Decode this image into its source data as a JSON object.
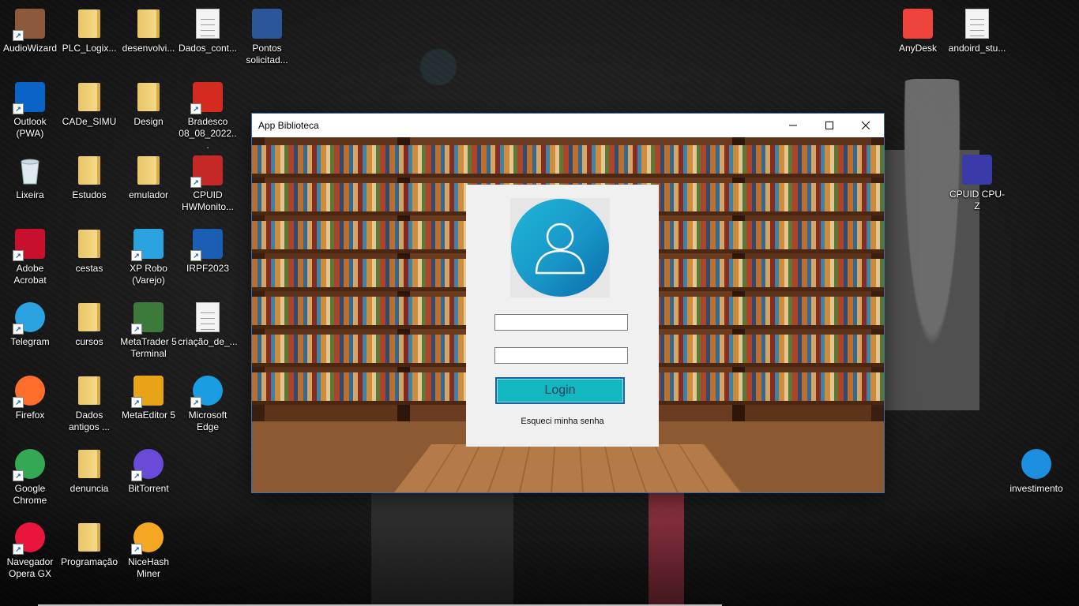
{
  "desktop": {
    "icons_left": [
      {
        "label": "AudioWizard",
        "icon": "speaker-icon",
        "color": "#8a5a3a"
      },
      {
        "label": "PLC_Logix...",
        "icon": "folder-icon"
      },
      {
        "label": "desenvolvi...",
        "icon": "folder-icon"
      },
      {
        "label": "Dados_cont...",
        "icon": "document-icon"
      },
      {
        "label": "Pontos solicitad...",
        "icon": "word-document-icon",
        "color": "#2b579a"
      },
      {
        "label": "Outlook (PWA)",
        "icon": "outlook-icon",
        "color": "#0a64c8"
      },
      {
        "label": "CADe_SIMU",
        "icon": "folder-icon"
      },
      {
        "label": "Design",
        "icon": "folder-icon"
      },
      {
        "label": "Bradesco 08_08_2022...",
        "icon": "pdf-icon",
        "color": "#d42a1f"
      },
      {
        "label": "Lixeira",
        "icon": "recycle-bin-icon"
      },
      {
        "label": "Estudos",
        "icon": "folder-icon"
      },
      {
        "label": "emulador",
        "icon": "folder-icon"
      },
      {
        "label": "CPUID HWMonito...",
        "icon": "hwmonitor-icon",
        "color": "#c62828"
      },
      {
        "label": "Adobe Acrobat",
        "icon": "acrobat-icon",
        "color": "#c8102e"
      },
      {
        "label": "cestas",
        "icon": "folder-icon"
      },
      {
        "label": "XP Robo (Varejo)",
        "icon": "robot-icon",
        "color": "#2aa3e0"
      },
      {
        "label": "IRPF2023",
        "icon": "irpf-icon",
        "color": "#1b5fb5"
      },
      {
        "label": "Telegram",
        "icon": "telegram-icon",
        "color": "#2aa3e0"
      },
      {
        "label": "cursos",
        "icon": "folder-icon"
      },
      {
        "label": "MetaTrader 5 Terminal",
        "icon": "metatrader-icon",
        "color": "#3c7a3c"
      },
      {
        "label": "criação_de_...",
        "icon": "document-icon"
      },
      {
        "label": "Firefox",
        "icon": "firefox-icon",
        "color": "#ff6d2a"
      },
      {
        "label": "Dados antigos ...",
        "icon": "folder-icon"
      },
      {
        "label": "MetaEditor 5",
        "icon": "metaeditor-icon",
        "color": "#e8a317"
      },
      {
        "label": "Microsoft Edge",
        "icon": "edge-icon",
        "color": "#1b9de2"
      },
      {
        "label": "Google Chrome",
        "icon": "chrome-icon",
        "color": "#34a853"
      },
      {
        "label": "denuncia",
        "icon": "folder-icon"
      },
      {
        "label": "BitTorrent",
        "icon": "bittorrent-icon",
        "color": "#6a4bd8"
      },
      {
        "label": "Navegador Opera GX",
        "icon": "opera-gx-icon",
        "color": "#e8163c"
      },
      {
        "label": "Programação",
        "icon": "folder-icon"
      },
      {
        "label": "NiceHash Miner",
        "icon": "nicehash-icon",
        "color": "#f5a623"
      }
    ],
    "icons_right": [
      {
        "label": "AnyDesk",
        "icon": "anydesk-icon",
        "color": "#ef443b"
      },
      {
        "label": "andoird_stu...",
        "icon": "document-icon"
      },
      {
        "label": "CPUID CPU-Z",
        "icon": "cpuz-icon",
        "color": "#3a3aa8"
      },
      {
        "label": "investimento",
        "icon": "investimento-icon",
        "color": "#1d8fe0"
      }
    ]
  },
  "window": {
    "title": "App Biblioteca",
    "controls": {
      "minimize": "—",
      "maximize": "☐",
      "close": "✕"
    }
  },
  "login": {
    "username_value": "",
    "password_value": "",
    "button_label": "Login",
    "forgot_label": "Esqueci minha senha",
    "accent": "#12b7bf"
  }
}
